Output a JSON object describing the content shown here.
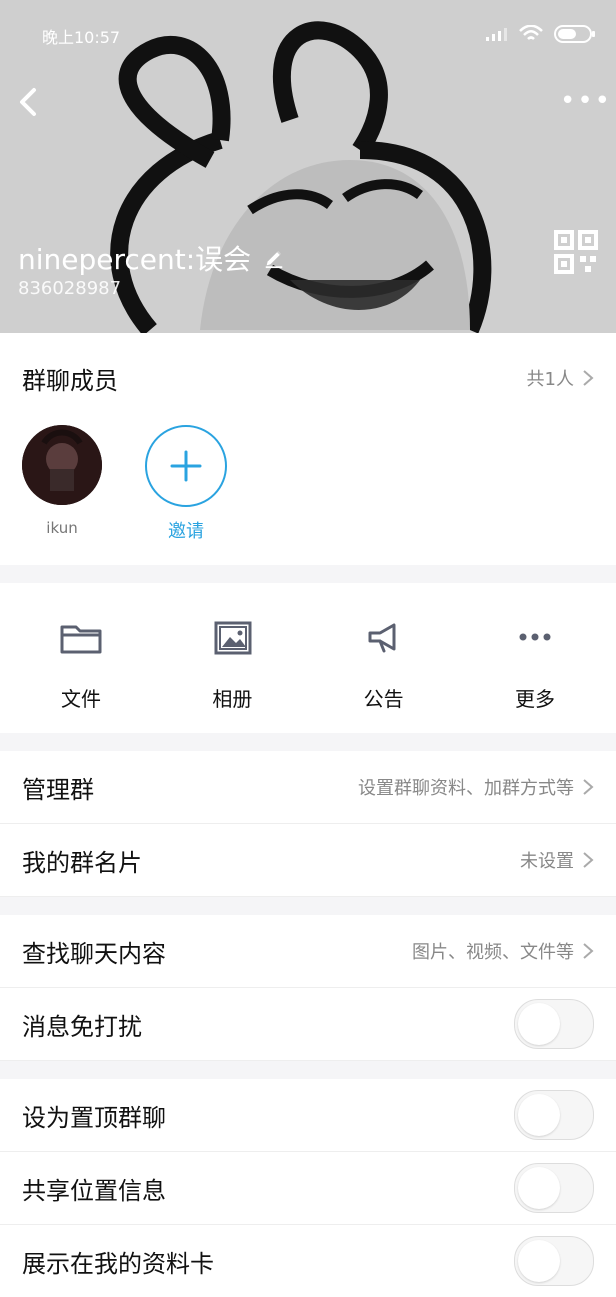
{
  "status_bar": {
    "time": "晚上10:57"
  },
  "header": {
    "group_name": "ninepercent:误会",
    "group_id": "836028987",
    "more_label": "•••"
  },
  "members": {
    "title": "群聊成员",
    "count_text": "共1人",
    "items": [
      {
        "name": "ikun"
      }
    ],
    "invite_label": "邀请"
  },
  "tools": [
    {
      "label": "文件",
      "icon": "folder-icon"
    },
    {
      "label": "相册",
      "icon": "photo-album-icon"
    },
    {
      "label": "公告",
      "icon": "megaphone-icon"
    },
    {
      "label": "更多",
      "icon": "more-dots-icon"
    }
  ],
  "settings": {
    "manage": {
      "title": "管理群",
      "value": "设置群聊资料、加群方式等"
    },
    "card": {
      "title": "我的群名片",
      "value": "未设置"
    },
    "search": {
      "title": "查找聊天内容",
      "value": "图片、视频、文件等"
    },
    "dnd": {
      "title": "消息免打扰"
    },
    "pin": {
      "title": "设为置顶群聊"
    },
    "location": {
      "title": "共享位置信息"
    },
    "showcard": {
      "title": "展示在我的资料卡"
    }
  },
  "colors": {
    "accent": "#2aa3e0",
    "header_bg": "#cfcfcf",
    "icon_gray": "#5b6070"
  }
}
